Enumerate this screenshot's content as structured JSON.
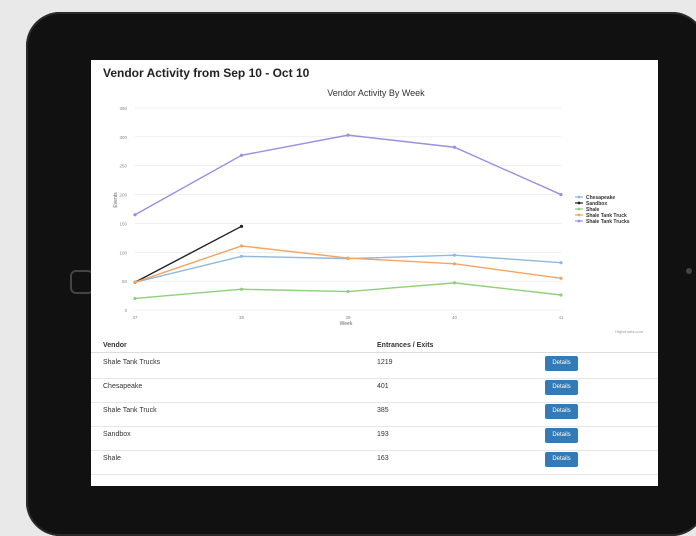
{
  "page": {
    "title": "Vendor Activity from Sep 10 - Oct 10"
  },
  "colors": {
    "screen_bg": "#ffffff",
    "button": "#337ab7"
  },
  "chart_data": {
    "type": "line",
    "title": "Vendor Activity By Week",
    "xlabel": "Week",
    "ylabel": "Events",
    "x": [
      "37",
      "38",
      "39",
      "40",
      "41"
    ],
    "y_ticks": [
      "0",
      "50",
      "100",
      "150",
      "200",
      "250",
      "300",
      "350"
    ],
    "ylim": [
      0,
      350
    ],
    "grid": true,
    "legend_position": "right",
    "credit": "Highcharts.com",
    "series": [
      {
        "name": "Chesapeake",
        "color": "#8fb9de",
        "values": [
          48,
          93,
          89,
          95,
          82
        ]
      },
      {
        "name": "Sandbox",
        "color": "#222222",
        "values": [
          48,
          145,
          null,
          null,
          null
        ]
      },
      {
        "name": "Shale",
        "color": "#8fd07a",
        "values": [
          20,
          36,
          32,
          47,
          26
        ]
      },
      {
        "name": "Shale Tank Truck",
        "color": "#f4a460",
        "values": [
          48,
          111,
          90,
          80,
          55
        ]
      },
      {
        "name": "Shale Tank Trucks",
        "color": "#9b8fe0",
        "values": [
          165,
          268,
          303,
          282,
          200
        ]
      }
    ]
  },
  "table": {
    "headers": {
      "vendor": "Vendor",
      "entrances": "Entrances / Exits"
    },
    "rows": [
      {
        "vendor": "Shale Tank Trucks",
        "count": "1219",
        "action": "Details"
      },
      {
        "vendor": "Chesapeake",
        "count": "401",
        "action": "Details"
      },
      {
        "vendor": "Shale Tank Truck",
        "count": "385",
        "action": "Details"
      },
      {
        "vendor": "Sandbox",
        "count": "193",
        "action": "Details"
      },
      {
        "vendor": "Shale",
        "count": "163",
        "action": "Details"
      }
    ]
  }
}
